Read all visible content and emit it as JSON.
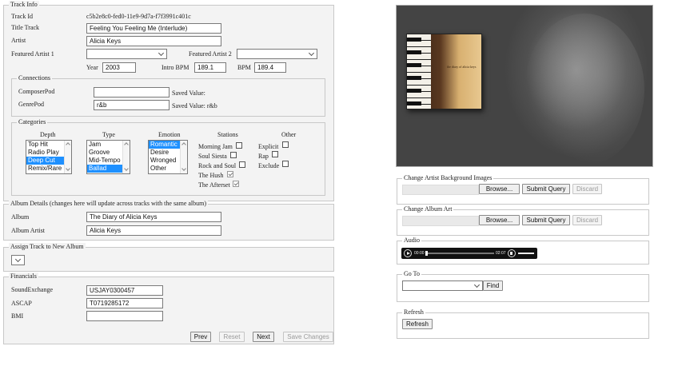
{
  "track_info": {
    "legend": "Track Info",
    "track_id_label": "Track Id",
    "track_id_value": "c5b2e8c0-fed0-11e9-9d7a-f7f3991c401c",
    "title_label": "Title Track",
    "title_value": "Feeling You Feeling Me (Interlude)",
    "artist_label": "Artist",
    "artist_value": "Alicia Keys",
    "featured1_label": "Featured Artist 1",
    "featured2_label": "Featured Artist 2",
    "year_label": "Year",
    "year_value": "2003",
    "intro_bpm_label": "Intro BPM",
    "intro_bpm_value": "189.1",
    "bpm_label": "BPM",
    "bpm_value": "189.4"
  },
  "connections": {
    "legend": "Connections",
    "composer_label": "ComposerPod",
    "composer_value": "",
    "composer_saved": "Saved Value:",
    "genre_label": "GenrePod",
    "genre_value": "r&b",
    "genre_saved": "Saved Value: r&b"
  },
  "categories": {
    "legend": "Categories",
    "depth_label": "Depth",
    "depth_options": [
      "Top Hit",
      "Radio Play",
      "Deep Cut",
      "Remix/Rare"
    ],
    "type_label": "Type",
    "type_options": [
      "Jam",
      "Groove",
      "Mid-Tempo",
      "Ballad"
    ],
    "emotion_label": "Emotion",
    "emotion_options": [
      "Romantic",
      "Desire",
      "Wronged",
      "Other"
    ],
    "stations_label": "Stations",
    "stations": [
      "Morning Jam",
      "Soul Siesta",
      "Rock and Soul",
      "The Hush",
      "The Afterset"
    ],
    "other_label": "Other",
    "other": [
      "Explicit",
      "Rap",
      "Exclude"
    ]
  },
  "album_details": {
    "legend": "Album Details (changes here will update across tracks with the same album)",
    "album_label": "Album",
    "album_value": "The Diary of Alicia Keys",
    "album_artist_label": "Album Artist",
    "album_artist_value": "Alicia Keys"
  },
  "assign_album": {
    "legend": "Assign Track to New Album"
  },
  "financials": {
    "legend": "Financials",
    "soundexchange_label": "SoundExchange",
    "soundexchange_value": "USJAY0300457",
    "ascap_label": "ASCAP",
    "ascap_value": "T0719285172",
    "bmi_label": "BMI",
    "bmi_value": ""
  },
  "footer_buttons": {
    "prev": "Prev",
    "reset": "Reset",
    "next": "Next",
    "save": "Save Changes"
  },
  "right_panel": {
    "bg_images_legend": "Change Artist Background Images",
    "album_art_legend": "Change Album Art",
    "browse": "Browse...",
    "submit": "Submit Query",
    "discard": "Discard",
    "audio_legend": "Audio",
    "audio_current": "00:00",
    "audio_total": "02:07",
    "goto_legend": "Go To",
    "find": "Find",
    "refresh_legend": "Refresh",
    "refresh": "Refresh",
    "album_art_title": "the diary of alicia keys"
  }
}
